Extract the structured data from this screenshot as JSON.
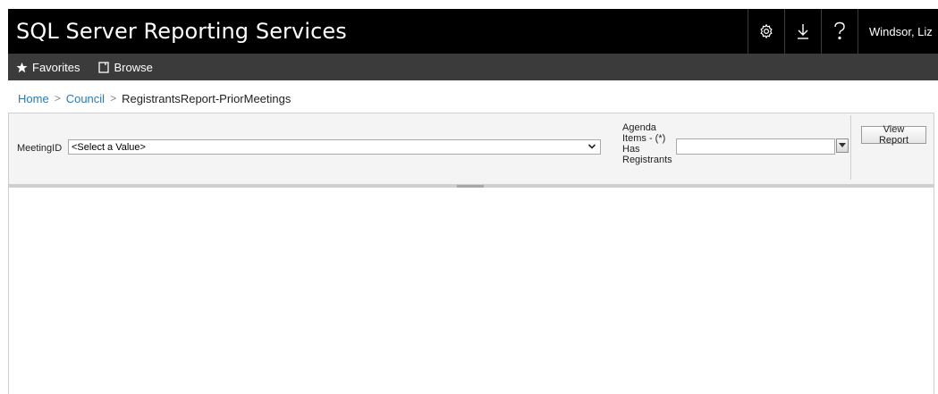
{
  "app": {
    "title": "SQL Server Reporting Services",
    "user": "Windsor, Liz"
  },
  "header_icons": [
    "settings-gear-icon",
    "download-arrow-icon",
    "help-question-icon"
  ],
  "subnav": {
    "favorites_label": "Favorites",
    "browse_label": "Browse"
  },
  "breadcrumb": {
    "home": "Home",
    "folder": "Council",
    "current": "RegistrantsReport-PriorMeetings"
  },
  "parameters": {
    "meeting_label": "MeetingID",
    "meeting_value": "<Select a Value>",
    "agenda_label": "Agenda Items - (*) Has Registrants",
    "agenda_value": ""
  },
  "toolbar": {
    "view_report_label": "View Report"
  },
  "colors": {
    "header_bg": "#000000",
    "subnav_bg": "#3b3b3b",
    "link": "#2a7ab9",
    "param_bg": "#f4f4f4"
  }
}
